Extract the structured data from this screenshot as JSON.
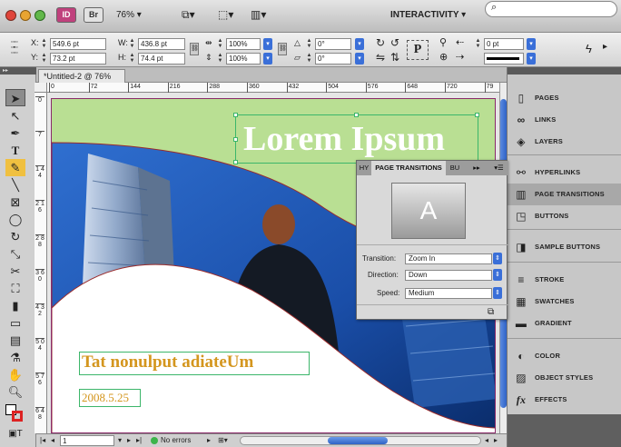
{
  "app": {
    "badges": [
      "ID",
      "Br"
    ],
    "zoom": "76%",
    "workspace": "INTERACTIVITY"
  },
  "control_bar": {
    "x_label": "X:",
    "x_value": "549.6 pt",
    "y_label": "Y:",
    "y_value": "73.2 pt",
    "w_label": "W:",
    "w_value": "436.8 pt",
    "h_label": "H:",
    "h_value": "74.4 pt",
    "scale_x": "100%",
    "scale_y": "100%",
    "rotate": "0°",
    "shear": "0°",
    "stroke_weight": "0 pt"
  },
  "document": {
    "tab_title": "*Untitled-2 @ 76%",
    "ruler_ticks": [
      "0",
      "72",
      "144",
      "216",
      "288",
      "360",
      "432",
      "504",
      "576",
      "648",
      "720",
      "79"
    ],
    "vruler_ticks": [
      "0",
      "7",
      "1 4 4",
      "2 1 6",
      "2 8 8",
      "3 6 0",
      "4 3 2",
      "5 0 4",
      "5 7 6",
      "6 4 8"
    ],
    "headline": "Lorem Ipsum",
    "subtitle": "Tat nonulput adiateUm",
    "date": "2008.5.25"
  },
  "status_bar": {
    "page_number": "1",
    "preflight": "No errors"
  },
  "page_transitions_panel": {
    "tabs": [
      "HY",
      "PAGE TRANSITIONS",
      "BU"
    ],
    "preview_letter": "A",
    "transition_label": "Transition:",
    "transition_value": "Zoom In",
    "direction_label": "Direction:",
    "direction_value": "Down",
    "speed_label": "Speed:",
    "speed_value": "Medium"
  },
  "dock": {
    "items": [
      {
        "label": "PAGES",
        "icon": "pages-icon"
      },
      {
        "label": "LINKS",
        "icon": "links-icon"
      },
      {
        "label": "LAYERS",
        "icon": "layers-icon"
      },
      {
        "label": "HYPERLINKS",
        "icon": "hyperlinks-icon"
      },
      {
        "label": "PAGE TRANSITIONS",
        "icon": "page-transitions-icon"
      },
      {
        "label": "BUTTONS",
        "icon": "buttons-icon"
      },
      {
        "label": "SAMPLE BUTTONS",
        "icon": "sample-buttons-icon"
      },
      {
        "label": "STROKE",
        "icon": "stroke-icon"
      },
      {
        "label": "SWATCHES",
        "icon": "swatches-icon"
      },
      {
        "label": "GRADIENT",
        "icon": "gradient-icon"
      },
      {
        "label": "COLOR",
        "icon": "color-icon"
      },
      {
        "label": "OBJECT STYLES",
        "icon": "object-styles-icon"
      },
      {
        "label": "EFFECTS",
        "icon": "effects-icon",
        "glyph": "fx"
      }
    ]
  },
  "colors": {
    "accent": "#3a6fd8",
    "headline_bg": "#b9df93",
    "subtitle_text": "#d4961e",
    "frame_outline": "#3cb66a"
  }
}
